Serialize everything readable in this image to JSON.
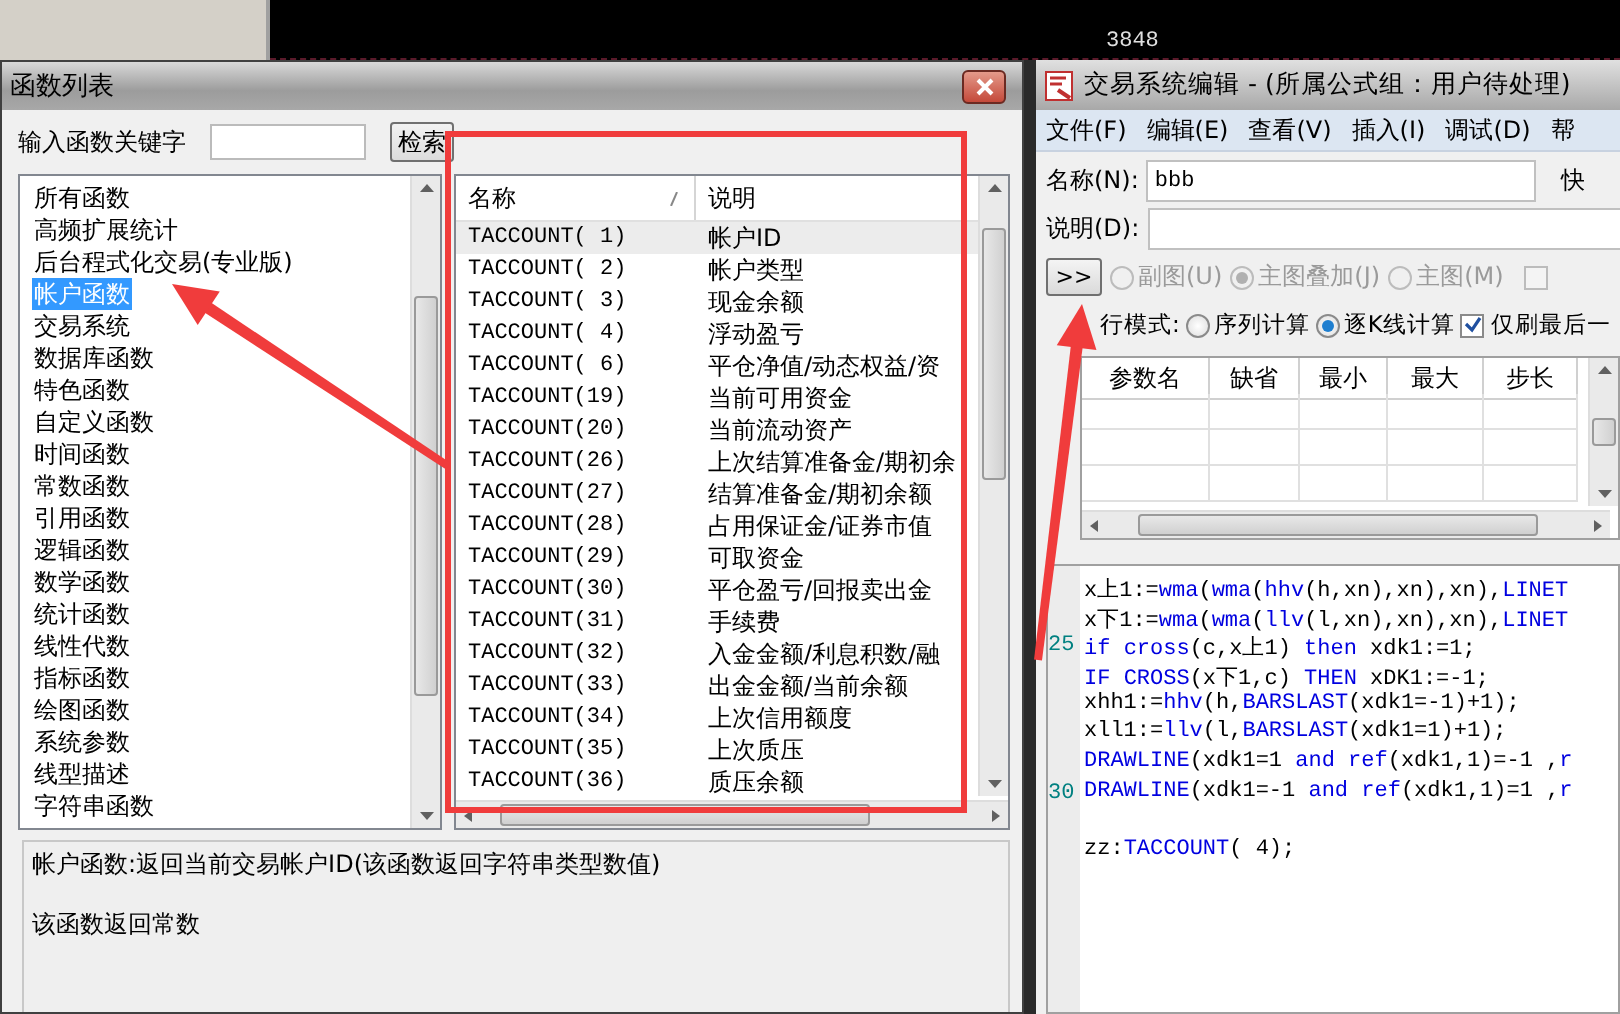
{
  "chart_strip": {
    "price_label": "3848"
  },
  "function_list": {
    "title": "函数列表",
    "search": {
      "label": "输入函数关键字",
      "button": "检索"
    },
    "categories": [
      {
        "label": "所有函数",
        "selected": false
      },
      {
        "label": "高频扩展统计",
        "selected": false
      },
      {
        "label": "后台程式化交易(专业版)",
        "selected": false
      },
      {
        "label": "帐户函数",
        "selected": true
      },
      {
        "label": "交易系统",
        "selected": false
      },
      {
        "label": "数据库函数",
        "selected": false
      },
      {
        "label": "特色函数",
        "selected": false
      },
      {
        "label": "自定义函数",
        "selected": false
      },
      {
        "label": "时间函数",
        "selected": false
      },
      {
        "label": "常数函数",
        "selected": false
      },
      {
        "label": "引用函数",
        "selected": false
      },
      {
        "label": "逻辑函数",
        "selected": false
      },
      {
        "label": "数学函数",
        "selected": false
      },
      {
        "label": "统计函数",
        "selected": false
      },
      {
        "label": "线性代数",
        "selected": false
      },
      {
        "label": "指标函数",
        "selected": false
      },
      {
        "label": "绘图函数",
        "selected": false
      },
      {
        "label": "系统参数",
        "selected": false
      },
      {
        "label": "线型描述",
        "selected": false
      },
      {
        "label": "字符串函数",
        "selected": false
      }
    ],
    "table": {
      "columns": [
        "名称",
        "说明"
      ],
      "rows": [
        {
          "name": "TACCOUNT( 1)",
          "description": "帐户ID",
          "selected": true
        },
        {
          "name": "TACCOUNT( 2)",
          "description": "帐户类型",
          "selected": false
        },
        {
          "name": "TACCOUNT( 3)",
          "description": "现金余额",
          "selected": false
        },
        {
          "name": "TACCOUNT( 4)",
          "description": "浮动盈亏",
          "selected": false
        },
        {
          "name": "TACCOUNT( 6)",
          "description": "平仓净值/动态权益/资",
          "selected": false
        },
        {
          "name": "TACCOUNT(19)",
          "description": "当前可用资金",
          "selected": false
        },
        {
          "name": "TACCOUNT(20)",
          "description": "当前流动资产",
          "selected": false
        },
        {
          "name": "TACCOUNT(26)",
          "description": "上次结算准备金/期初余",
          "selected": false
        },
        {
          "name": "TACCOUNT(27)",
          "description": "结算准备金/期初余额",
          "selected": false
        },
        {
          "name": "TACCOUNT(28)",
          "description": "占用保证金/证券市值",
          "selected": false
        },
        {
          "name": "TACCOUNT(29)",
          "description": "可取资金",
          "selected": false
        },
        {
          "name": "TACCOUNT(30)",
          "description": "平仓盈亏/回报卖出金",
          "selected": false
        },
        {
          "name": "TACCOUNT(31)",
          "description": "手续费",
          "selected": false
        },
        {
          "name": "TACCOUNT(32)",
          "description": "入金金额/利息积数/融",
          "selected": false
        },
        {
          "name": "TACCOUNT(33)",
          "description": "出金金额/当前余额",
          "selected": false
        },
        {
          "name": "TACCOUNT(34)",
          "description": "上次信用额度",
          "selected": false
        },
        {
          "name": "TACCOUNT(35)",
          "description": "上次质压",
          "selected": false
        },
        {
          "name": "TACCOUNT(36)",
          "description": "质压余额",
          "selected": false
        }
      ]
    },
    "description": [
      "帐户函数:返回当前交易帐户ID(该函数返回字符串类型数值)",
      "该函数返回常数"
    ]
  },
  "editor": {
    "title": "交易系统编辑 - (所属公式组：用户待处理)",
    "menu": [
      "文件(F)",
      "编辑(E)",
      "查看(V)",
      "插入(I)",
      "调试(D)",
      "帮"
    ],
    "name_field": {
      "label": "名称(N):",
      "value": "bbb"
    },
    "shortcut_label": "快",
    "description_field": {
      "label": "说明(D):"
    },
    "expand_button": ">>",
    "chart_options": [
      {
        "label": "副图(U)",
        "selected": false,
        "disabled": true
      },
      {
        "label": "主图叠加(J)",
        "selected": true,
        "disabled": true
      },
      {
        "label": "主图(M)",
        "selected": false,
        "disabled": true
      }
    ],
    "chart_checkbox": {
      "checked": false
    },
    "run_mode": {
      "label": "行模式:",
      "options": [
        {
          "label": "序列计算",
          "selected": false
        },
        {
          "label": "逐K线计算",
          "selected": true
        }
      ],
      "refresh_last": {
        "label": "仅刷最后一",
        "checked": true
      }
    },
    "params_table": {
      "columns": [
        "参数名",
        "缺省",
        "最小",
        "最大",
        "步长"
      ]
    },
    "code": [
      {
        "tokens": [
          {
            "text": "x上1:=",
            "kind": "plain"
          },
          {
            "text": "wma",
            "kind": "func"
          },
          {
            "text": "(",
            "kind": "plain"
          },
          {
            "text": "wma",
            "kind": "func"
          },
          {
            "text": "(",
            "kind": "plain"
          },
          {
            "text": "hhv",
            "kind": "func"
          },
          {
            "text": "(h,xn),xn),xn),",
            "kind": "plain"
          },
          {
            "text": "LINET",
            "kind": "func"
          }
        ]
      },
      {
        "tokens": [
          {
            "text": "x下1:=",
            "kind": "plain"
          },
          {
            "text": "wma",
            "kind": "func"
          },
          {
            "text": "(",
            "kind": "plain"
          },
          {
            "text": "wma",
            "kind": "func"
          },
          {
            "text": "(",
            "kind": "plain"
          },
          {
            "text": "llv",
            "kind": "func"
          },
          {
            "text": "(l,xn),xn),xn),",
            "kind": "plain"
          },
          {
            "text": "LINET",
            "kind": "func"
          }
        ]
      },
      {
        "number": "25",
        "tokens": [
          {
            "text": "if ",
            "kind": "func"
          },
          {
            "text": "cross",
            "kind": "func"
          },
          {
            "text": "(c,x上1) ",
            "kind": "plain"
          },
          {
            "text": "then",
            "kind": "func"
          },
          {
            "text": " xdk1:=1;",
            "kind": "plain"
          }
        ]
      },
      {
        "tokens": [
          {
            "text": "IF ",
            "kind": "func"
          },
          {
            "text": "CROSS",
            "kind": "func"
          },
          {
            "text": "(x下1,c) ",
            "kind": "plain"
          },
          {
            "text": "THEN",
            "kind": "func"
          },
          {
            "text": " xDK1:=-1;",
            "kind": "plain"
          }
        ]
      },
      {
        "tokens": [
          {
            "text": "xhh1:=",
            "kind": "plain"
          },
          {
            "text": "hhv",
            "kind": "func"
          },
          {
            "text": "(h,",
            "kind": "plain"
          },
          {
            "text": "BARSLAST",
            "kind": "func"
          },
          {
            "text": "(xdk1=-1)+1);",
            "kind": "plain"
          }
        ]
      },
      {
        "tokens": [
          {
            "text": "xll1:=",
            "kind": "plain"
          },
          {
            "text": "llv",
            "kind": "func"
          },
          {
            "text": "(l,",
            "kind": "plain"
          },
          {
            "text": "BARSLAST",
            "kind": "func"
          },
          {
            "text": "(xdk1=1)+1);",
            "kind": "plain"
          }
        ]
      },
      {
        "tokens": [
          {
            "text": "DRAWLINE",
            "kind": "func"
          },
          {
            "text": "(xdk1=1 ",
            "kind": "plain"
          },
          {
            "text": "and ",
            "kind": "func"
          },
          {
            "text": "ref",
            "kind": "func"
          },
          {
            "text": "(xdk1,1)=-1 ,",
            "kind": "plain"
          },
          {
            "text": "r",
            "kind": "func"
          }
        ]
      },
      {
        "number": "30",
        "tokens": [
          {
            "text": "DRAWLINE",
            "kind": "func"
          },
          {
            "text": "(xdk1=-1 ",
            "kind": "plain"
          },
          {
            "text": "and ",
            "kind": "func"
          },
          {
            "text": "ref",
            "kind": "func"
          },
          {
            "text": "(xdk1,1)=1 ,",
            "kind": "plain"
          },
          {
            "text": "r",
            "kind": "func"
          }
        ]
      },
      {
        "gap_before": true,
        "tokens": [
          {
            "text": "zz:",
            "kind": "plain"
          },
          {
            "text": "TACCOUNT",
            "kind": "func"
          },
          {
            "text": "( 4);",
            "kind": "plain"
          }
        ]
      }
    ]
  }
}
